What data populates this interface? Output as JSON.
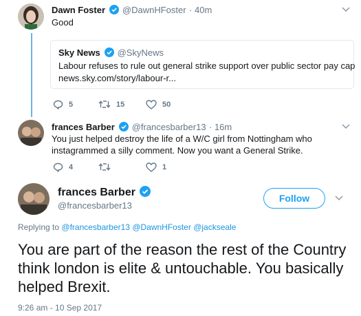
{
  "tweet1": {
    "name": "Dawn Foster",
    "handle": "@DawnHFoster",
    "time": "· 40m",
    "text": "Good",
    "quote": {
      "name": "Sky News",
      "handle": "@SkyNews",
      "text": "Labour refuses to rule out general strike support over public sector pay cap",
      "link": "news.sky.com/story/labour-r..."
    },
    "actions": {
      "replies": "5",
      "retweets": "15",
      "likes": "50"
    }
  },
  "tweet2": {
    "name": "frances Barber",
    "handle": "@francesbarber13",
    "time": "· 16m",
    "text_line1": "You just helped destroy the life of a W/C girl from Nottingham who",
    "text_line2": "instagrammed a silly comment. Now you want a General Strike.",
    "actions": {
      "replies": "4",
      "retweets": "",
      "likes": "1"
    }
  },
  "main_tweet": {
    "name": "frances Barber",
    "handle": "@francesbarber13",
    "follow_label": "Follow",
    "replying_prefix": "Replying to",
    "replying_to": [
      "@francesbarber13",
      "@DawnHFoster",
      "@jackseale"
    ],
    "text": "You are part of the reason the rest of the Country think london is elite & untouchable. You basically helped Brexit.",
    "timestamp": "9:26 am - 10 Sep 2017"
  },
  "colors": {
    "accent": "#1da1f2",
    "link": "#1b95e0",
    "muted": "#657786",
    "thread_line": "#6ab2e8"
  }
}
